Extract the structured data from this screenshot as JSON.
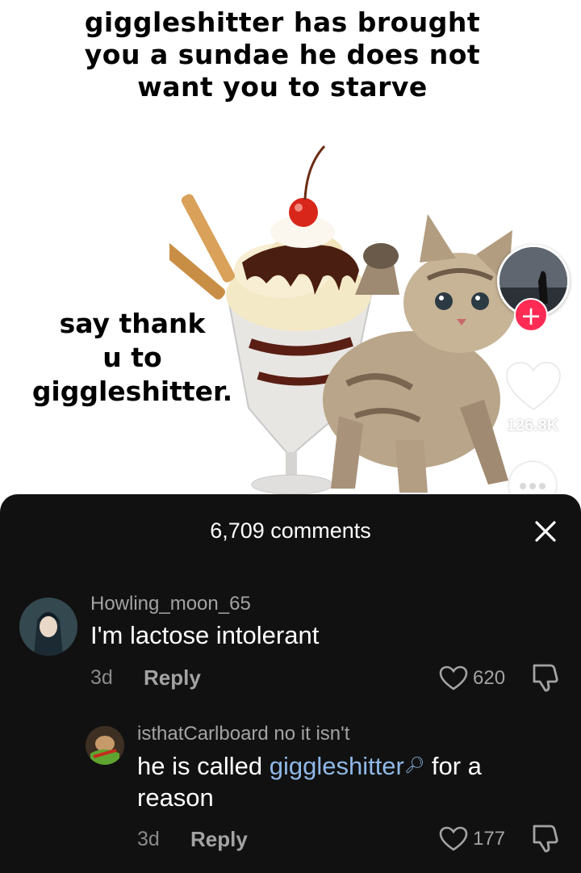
{
  "video": {
    "top_caption": "giggleshitter has brought you a sundae he does not want you to starve",
    "side_caption_lines": [
      "say thank",
      "u to",
      "giggleshitter."
    ],
    "like_count": "126.8K"
  },
  "comments_panel": {
    "title": "6,709 comments",
    "comments": [
      {
        "username": "Howling_moon_65",
        "text": "I'm lactose intolerant",
        "age": "3d",
        "reply_label": "Reply",
        "likes": "620"
      },
      {
        "username": "isthatCarlboard",
        "reply_context": " no it isn't",
        "text_before": "he is called ",
        "link_text": "giggleshitter",
        "text_after": " for a reason",
        "age": "3d",
        "reply_label": "Reply",
        "likes": "177"
      }
    ]
  },
  "colors": {
    "sheet_bg": "#111111",
    "follow_accent": "#fe2c55",
    "link": "#8fb8e6",
    "muted_text": "#a3a3a3"
  },
  "icons": [
    "plus-icon",
    "heart-icon",
    "more-icon",
    "close-icon",
    "dislike-icon"
  ]
}
